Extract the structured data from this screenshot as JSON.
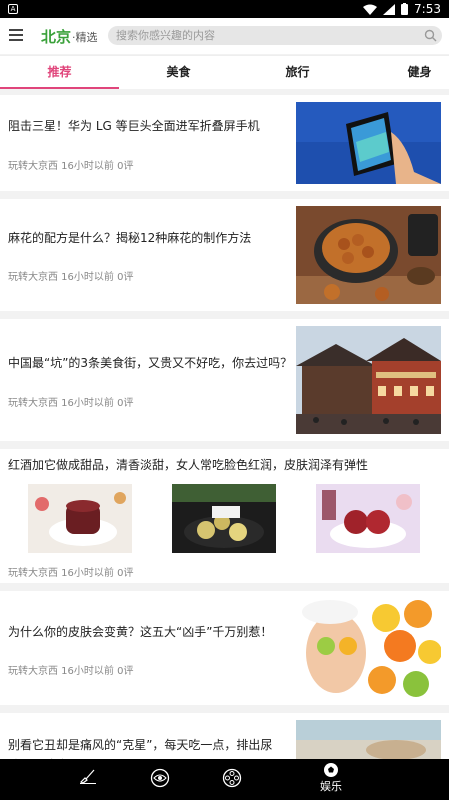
{
  "status_bar": {
    "time": "7:53",
    "notif_icon": "A"
  },
  "header": {
    "city": "北京",
    "city_suffix": "·精选",
    "search_placeholder": "搜索你感兴趣的内容"
  },
  "tabs": [
    {
      "label": "推荐",
      "active": true
    },
    {
      "label": "美食",
      "active": false
    },
    {
      "label": "旅行",
      "active": false
    },
    {
      "label": "健身",
      "active": false
    }
  ],
  "articles": [
    {
      "title": "阻击三星！华为 LG 等巨头全面进军折叠屏手机",
      "meta": "玩转大京西 16小时以前 0评"
    },
    {
      "title": "麻花的配方是什么？揭秘12种麻花的制作方法",
      "meta": "玩转大京西 16小时以前 0评"
    },
    {
      "title": "中国最“坑”的3条美食街，又贵又不好吃，你去过吗？",
      "meta": "玩转大京西 16小时以前 0评"
    },
    {
      "title": "红酒加它做成甜品，清香淡甜，女人常吃脸色红润，皮肤润泽有弹性",
      "meta": "玩转大京西 16小时以前 0评"
    },
    {
      "title": "为什么你的皮肤会变黄？这五大“凶手”千万别惹！",
      "meta": "玩转大京西 16小时以前 0评"
    },
    {
      "title": "别看它丑却是痛风的“克星”，每天吃一点，排出尿酸，预防痛风",
      "meta": ""
    }
  ],
  "bottom_nav": [
    {
      "icon": "brush-icon",
      "label": ""
    },
    {
      "icon": "eye-icon",
      "label": ""
    },
    {
      "icon": "film-reel-icon",
      "label": ""
    },
    {
      "icon": "soccer-icon",
      "label": "娱乐"
    }
  ]
}
